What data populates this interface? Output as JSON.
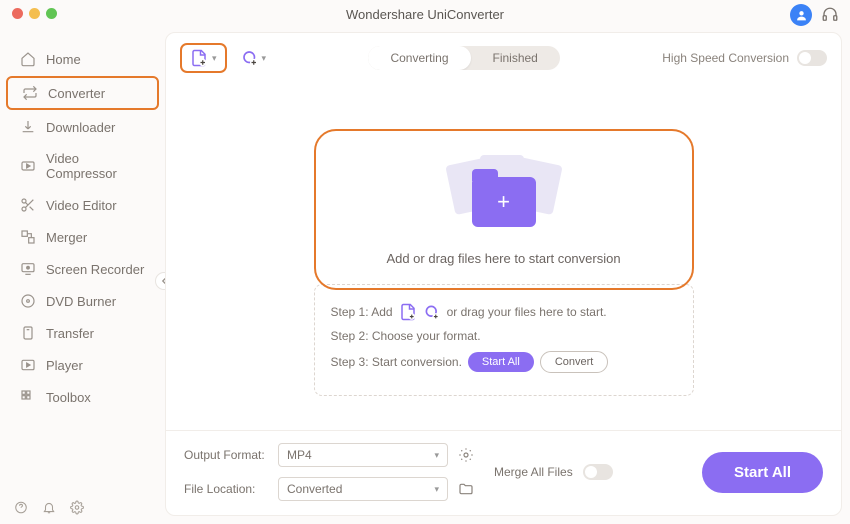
{
  "app": {
    "title": "Wondershare UniConverter"
  },
  "sidebar": {
    "items": [
      {
        "label": "Home"
      },
      {
        "label": "Converter"
      },
      {
        "label": "Downloader"
      },
      {
        "label": "Video Compressor"
      },
      {
        "label": "Video Editor"
      },
      {
        "label": "Merger"
      },
      {
        "label": "Screen Recorder"
      },
      {
        "label": "DVD Burner"
      },
      {
        "label": "Transfer"
      },
      {
        "label": "Player"
      },
      {
        "label": "Toolbox"
      }
    ]
  },
  "toolbar": {
    "tabs": {
      "converting": "Converting",
      "finished": "Finished"
    },
    "highSpeed": "High Speed Conversion"
  },
  "dropzone": {
    "text": "Add or drag files here to start conversion"
  },
  "steps": {
    "s1a": "Step 1: Add",
    "s1b": "or drag your files here to start.",
    "s2": "Step 2: Choose your format.",
    "s3": "Step 3: Start conversion.",
    "startAll": "Start  All",
    "convert": "Convert"
  },
  "footer": {
    "outputFormatLabel": "Output Format:",
    "outputFormatValue": "MP4",
    "fileLocationLabel": "File Location:",
    "fileLocationValue": "Converted",
    "mergeAll": "Merge All Files",
    "startAllBtn": "Start All"
  }
}
